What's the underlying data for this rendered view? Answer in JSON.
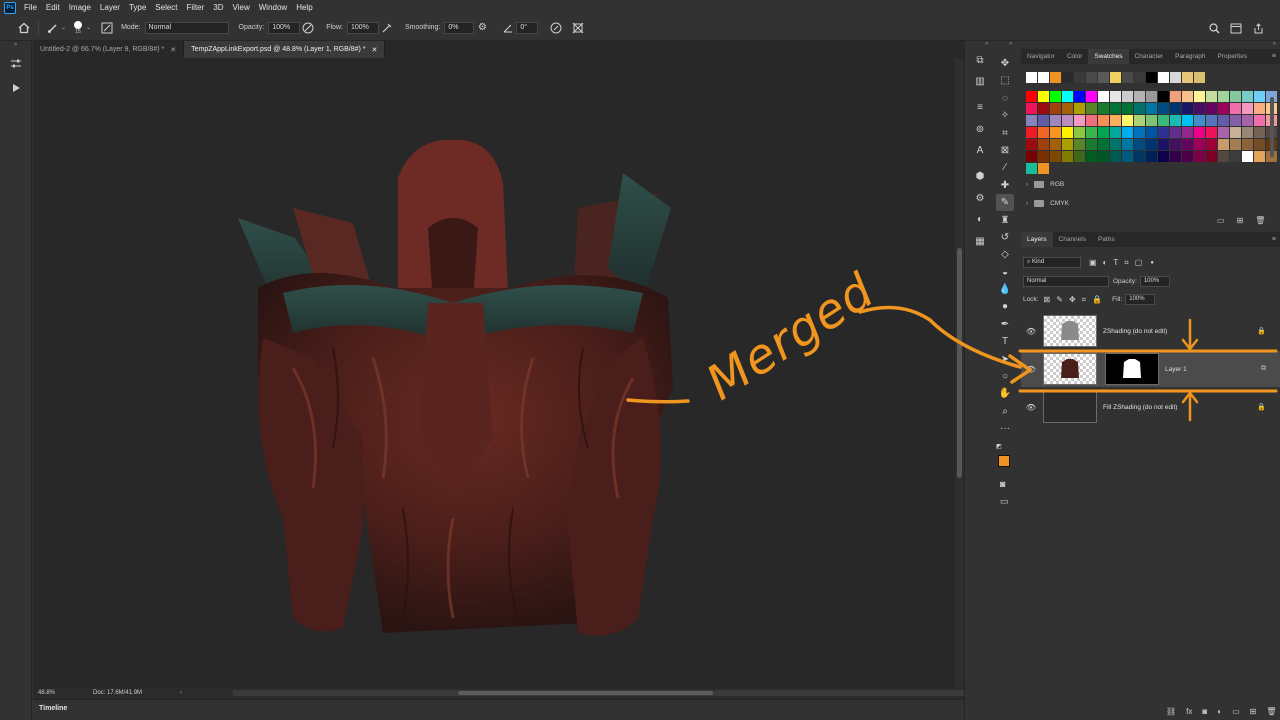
{
  "app": {
    "logo": "Ps"
  },
  "menu": [
    "File",
    "Edit",
    "Image",
    "Layer",
    "Type",
    "Select",
    "Filter",
    "3D",
    "View",
    "Window",
    "Help"
  ],
  "options": {
    "brush_size": "15",
    "mode_label": "Mode:",
    "mode_value": "Normal",
    "opacity_label": "Opacity:",
    "opacity_value": "100%",
    "flow_label": "Flow:",
    "flow_value": "100%",
    "smoothing_label": "Smoothing:",
    "smoothing_value": "0%",
    "angle_value": "0°"
  },
  "tabs": [
    {
      "label": "Untitled-2 @ 66.7% (Layer 9, RGB/8#) *",
      "active": false
    },
    {
      "label": "TempZAppLinkExport.psd @ 48.8% (Layer 1, RGB/8#) *",
      "active": true
    }
  ],
  "status": {
    "zoom": "48.8%",
    "doc": "Doc: 17.6M/41.9M"
  },
  "timeline": {
    "label": "Timeline"
  },
  "top_panel": {
    "tabs": [
      "Navigator",
      "Color",
      "Swatches",
      "Character",
      "Paragraph",
      "Properties"
    ],
    "active_tab": "Swatches",
    "recent_swatches": [
      "#ffffff",
      "#ffffff",
      "#ef9322",
      "#2a2a2a",
      "#3a3a3a",
      "#4a4a4a",
      "#5a5a5a",
      "#f0d060",
      "#4a4a4a",
      "#3a3a3a",
      "#000000",
      "#ffffff",
      "#d8d8d8",
      "#e8c878",
      "#d8c070"
    ],
    "swatches": [
      "#ff0000",
      "#ffff00",
      "#00ff00",
      "#00ffff",
      "#0000ff",
      "#ff00ff",
      "#ffffff",
      "#e6e6e6",
      "#cccccc",
      "#b3b3b3",
      "#999999",
      "#000000",
      "#f2a07b",
      "#f7c08b",
      "#fff39a",
      "#c4df9b",
      "#a3d39c",
      "#82ca9d",
      "#7accc8",
      "#6dcff6",
      "#7da7d9",
      "#ed145b",
      "#9e0b0f",
      "#a0410d",
      "#a36209",
      "#aba000",
      "#598527",
      "#1a7b30",
      "#007236",
      "#007236",
      "#00746b",
      "#0076a3",
      "#004b80",
      "#003471",
      "#1b1464",
      "#440e62",
      "#630460",
      "#9e005d",
      "#f06eaa",
      "#f49ac1",
      "#f9ad81",
      "#fdc68a",
      "#8882be",
      "#605ca8",
      "#a186be",
      "#bd8cbf",
      "#f49ac1",
      "#f26d7d",
      "#f68e56",
      "#fbaf5d",
      "#fff568",
      "#acd373",
      "#7cc576",
      "#3bb878",
      "#1abbb4",
      "#00bff3",
      "#438cca",
      "#5574b9",
      "#605ca8",
      "#855fa8",
      "#a763a8",
      "#f06eaa",
      "#f5989d",
      "#ed1c24",
      "#f26522",
      "#f7941d",
      "#fff200",
      "#8dc73f",
      "#39b54a",
      "#00a651",
      "#00a99d",
      "#00aeef",
      "#0072bc",
      "#0054a6",
      "#2e3192",
      "#662d91",
      "#92278f",
      "#ec008c",
      "#ed145b",
      "#a864a8",
      "#c7b299",
      "#998675",
      "#736357",
      "#534741",
      "#9e0b0f",
      "#a0410d",
      "#a36209",
      "#aba000",
      "#598527",
      "#197b30",
      "#007236",
      "#00746b",
      "#0076a3",
      "#004b80",
      "#003471",
      "#1b1464",
      "#440e62",
      "#630460",
      "#9e005d",
      "#9e0039",
      "#c69c6d",
      "#a67c52",
      "#8c6239",
      "#754c24",
      "#603913",
      "#790000",
      "#7b2e00",
      "#7d4900",
      "#827b00",
      "#406618",
      "#005e20",
      "#005826",
      "#005952",
      "#005b7f",
      "#003663",
      "#002157",
      "#0d004c",
      "#32004b",
      "#4b0049",
      "#7b0046",
      "#7a0026",
      "#534741",
      "#3c3c3c",
      "#ffffff",
      "#e3a35a",
      "#9e7040",
      "#1abc9c",
      "#ef9322"
    ],
    "folders": [
      "RGB",
      "CMYK"
    ]
  },
  "layers_panel": {
    "tabs": [
      "Layers",
      "Channels",
      "Paths"
    ],
    "active_tab": "Layers",
    "filter_value": "Kind",
    "blend_mode": "Normal",
    "opacity_label": "Opacity:",
    "opacity_value": "100%",
    "lock_label": "Lock:",
    "fill_label": "Fill:",
    "fill_value": "100%",
    "layers": [
      {
        "name": "ZShading (do not edit)",
        "locked": true
      },
      {
        "name": "Layer 1",
        "selected": true
      },
      {
        "name": "Fill ZShading (do not edit)",
        "locked": true
      }
    ]
  },
  "annotation": {
    "text": "Merged",
    "color": "#f0951e"
  }
}
